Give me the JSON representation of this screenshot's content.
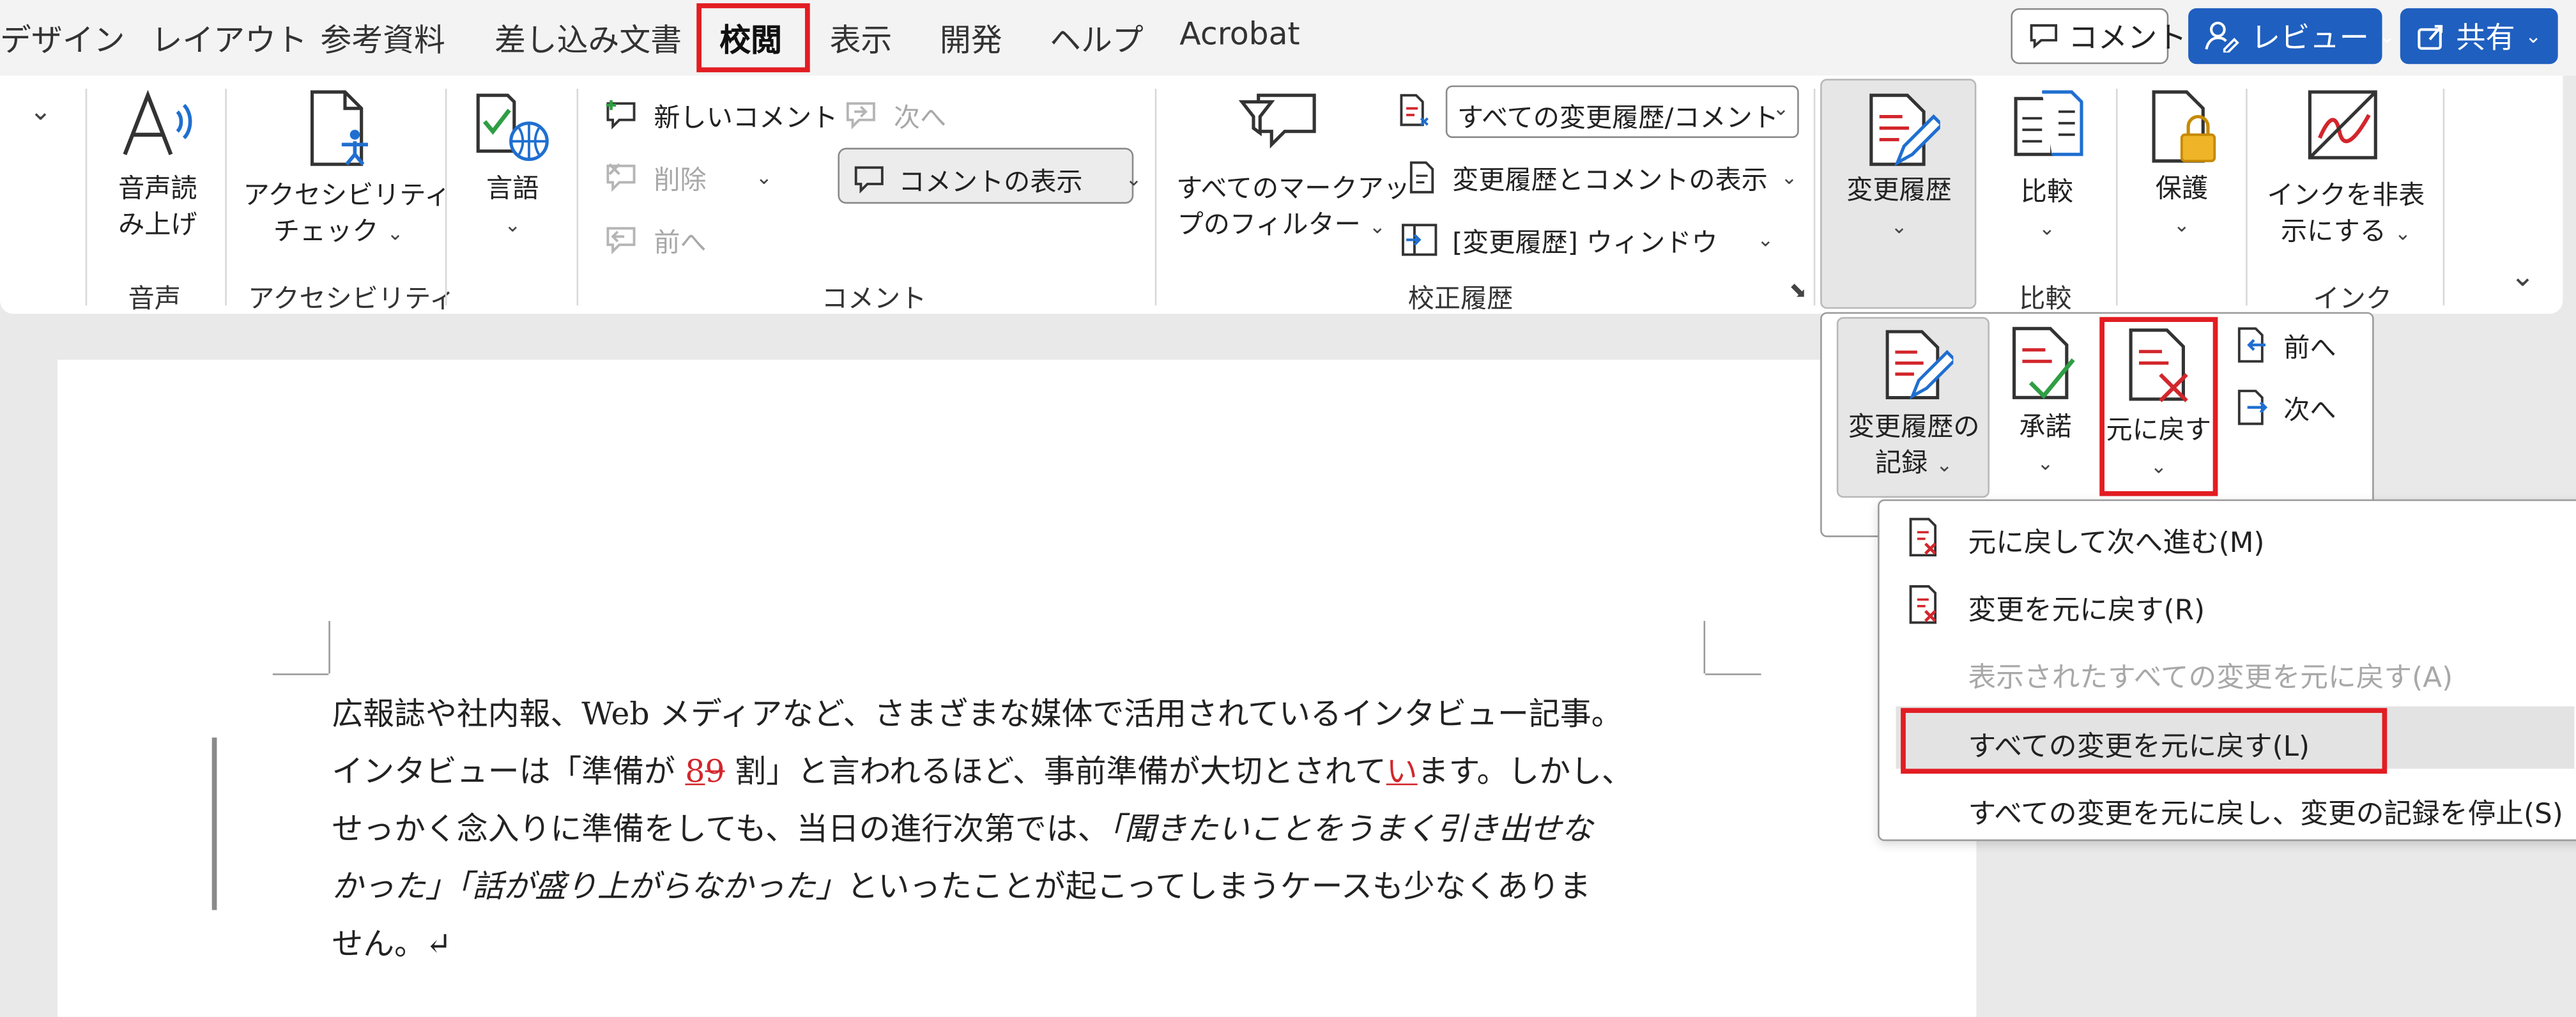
{
  "tabs": [
    "デザイン",
    "レイアウト",
    "参考資料",
    "差し込み文書",
    "校閲",
    "表示",
    "開発",
    "ヘルプ",
    "Acrobat"
  ],
  "top_buttons": {
    "comment": "コメント",
    "review": "レビュー",
    "share": "共有"
  },
  "ribbon": {
    "read_aloud": "音声読\nみ上げ",
    "read_aloud_line1": "音声読",
    "read_aloud_line2": "み上げ",
    "group_voice": "音声",
    "accessibility_line1": "アクセシビリティ",
    "accessibility_line2": "チェック",
    "group_accessibility": "アクセシビリティ",
    "language": "言語",
    "new_comment": "新しいコメント",
    "delete": "削除",
    "prev": "前へ",
    "next": "次へ",
    "show_comments": "コメントの表示",
    "group_comments": "コメント",
    "markup_filter_line1": "すべてのマークアッ",
    "markup_filter_line2": "プのフィルター",
    "markup_select": "すべての変更履歴/コメント",
    "show_markup": "変更履歴とコメントの表示",
    "reviewing_pane": "[変更履歴] ウィンドウ",
    "group_tracking": "校正履歴",
    "track_changes": "変更履歴",
    "compare": "比較",
    "group_compare": "比較",
    "protect": "保護",
    "hide_ink_line1": "インクを非表",
    "hide_ink_line2": "示にする",
    "group_ink": "インク"
  },
  "subpanel": {
    "record_line1": "変更履歴の",
    "record_line2": "記録",
    "accept": "承諾",
    "reject": "元に戻す",
    "prev": "前へ",
    "next": "次へ"
  },
  "menu": [
    {
      "label": "元に戻して次へ進む(M)",
      "enabled": true
    },
    {
      "label": "変更を元に戻す(R)",
      "enabled": true
    },
    {
      "label": "表示されたすべての変更を元に戻す(A)",
      "enabled": false
    },
    {
      "label": "すべての変更を元に戻す(L)",
      "enabled": true,
      "highlighted": true
    },
    {
      "label": "すべての変更を元に戻し、変更の記録を停止(S)",
      "enabled": true
    }
  ],
  "document": {
    "line1": "広報誌や社内報、Web メディアなど、さまざまな媒体で活用されているインタビュー記事。",
    "line2_a": "インタビューは「準備が ",
    "line2_ins": "8",
    "line2_del": "9",
    "line2_b": " 割」と言われるほど、事前準備が大切とされて",
    "line2_ins2": "い",
    "line2_c": "ます。しかし、",
    "line3_a": "せっかく念入りに準備をしても、当日の進行次第では、",
    "line3_b": "「聞きたいことをうまく引き出せな",
    "line4_a": "かった」「話が盛り上がらなかった」",
    "line4_b": "といったことが起こってしまうケースも少なくありま",
    "line5": "せん。↵"
  },
  "colors": {
    "accent_red": "#e21d23",
    "share_blue": "#1f5fbf",
    "revision_red": "#d2262c"
  }
}
